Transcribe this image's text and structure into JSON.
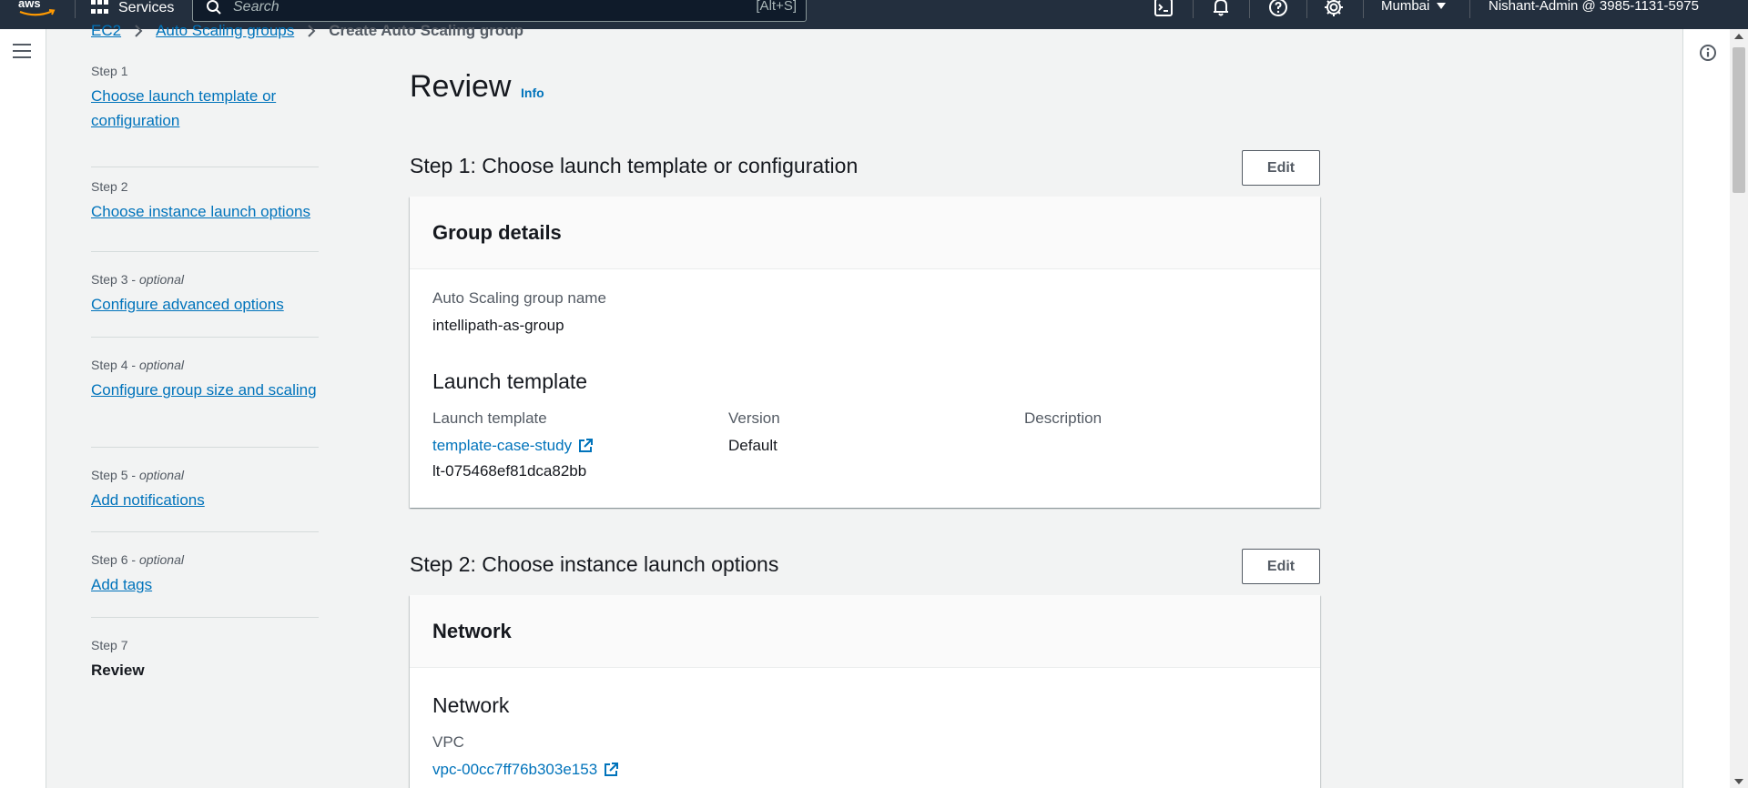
{
  "topnav": {
    "services_label": "Services",
    "search_placeholder": "Search",
    "search_shortcut": "[Alt+S]",
    "region": "Mumbai",
    "account": "Nishant-Admin @ 3985-1131-5975"
  },
  "breadcrumb": {
    "items": [
      "EC2",
      "Auto Scaling groups"
    ],
    "current": "Create Auto Scaling group"
  },
  "steps": [
    {
      "num": "Step 1",
      "optional": "",
      "label": "Choose launch template or configuration"
    },
    {
      "num": "Step 2",
      "optional": "",
      "label": "Choose instance launch options"
    },
    {
      "num": "Step 3",
      "optional": "optional",
      "label": "Configure advanced options"
    },
    {
      "num": "Step 4",
      "optional": "optional",
      "label": "Configure group size and scaling"
    },
    {
      "num": "Step 5",
      "optional": "optional",
      "label": "Add notifications"
    },
    {
      "num": "Step 6",
      "optional": "optional",
      "label": "Add tags"
    },
    {
      "num": "Step 7",
      "optional": "",
      "label": "Review"
    }
  ],
  "optional_sep": " - ",
  "main": {
    "title": "Review",
    "info_label": "Info",
    "edit_label": "Edit",
    "section1": {
      "title": "Step 1: Choose launch template or configuration",
      "panel_header": "Group details",
      "asg_name_label": "Auto Scaling group name",
      "asg_name_value": "intellipath-as-group",
      "launch_template_heading": "Launch template",
      "lt_label": "Launch template",
      "lt_link": "template-case-study",
      "lt_id": "lt-075468ef81dca82bb",
      "version_label": "Version",
      "version_value": "Default",
      "description_label": "Description"
    },
    "section2": {
      "title": "Step 2: Choose instance launch options",
      "panel_header": "Network",
      "network_heading": "Network",
      "vpc_label": "VPC",
      "vpc_link": "vpc-00cc7ff76b303e153"
    }
  },
  "colors": {
    "nav_bg": "#232f3e",
    "link": "#0073bb",
    "page_bg": "#f2f3f3"
  }
}
